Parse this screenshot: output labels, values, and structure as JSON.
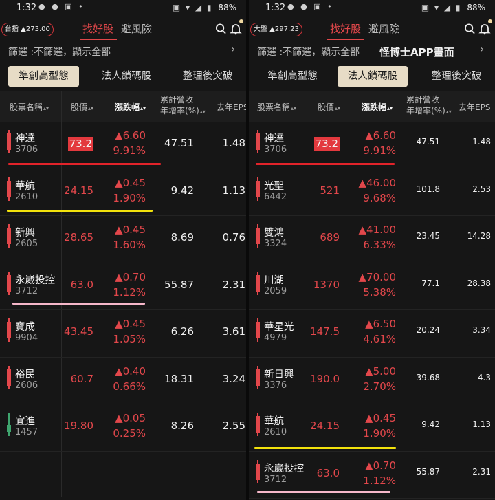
{
  "colors": {
    "up": "#e2474b",
    "down": "#3fa56e",
    "accent": "#e0474a",
    "red_line": "#e2232a",
    "yellow_line": "#f2e20c",
    "pink_line": "#f6b7c9"
  },
  "left": {
    "status": {
      "time": "1:32",
      "battery": "88%"
    },
    "index_badge": "台指 ▲273.00",
    "tabs": [
      "找好股",
      "避風險"
    ],
    "filter_label": "篩選 :不篩選，顯示全部",
    "filter_note": "",
    "segments": [
      "準創高型態",
      "法人鎖碼股",
      "整理後突破"
    ],
    "active_segment": 0,
    "headers": {
      "name": "股票名稱",
      "price": "股價",
      "change": "漲跌幅",
      "revenue": "累計營收",
      "revenue2": "年增率(%)",
      "eps": "去年EPS"
    },
    "rows": [
      {
        "name": "神達",
        "code": "3706",
        "price": "73.2",
        "highlight": true,
        "change": "▲6.60",
        "pct": "9.91%",
        "revenue": "47.51",
        "eps": "1.48",
        "candle": "up"
      },
      {
        "name": "華航",
        "code": "2610",
        "price": "24.15",
        "highlight": false,
        "change": "▲0.45",
        "pct": "1.90%",
        "revenue": "9.42",
        "eps": "1.13",
        "candle": "up"
      },
      {
        "name": "新興",
        "code": "2605",
        "price": "28.65",
        "highlight": false,
        "change": "▲0.45",
        "pct": "1.60%",
        "revenue": "8.69",
        "eps": "0.76",
        "candle": "up"
      },
      {
        "name": "永崴投控",
        "code": "3712",
        "price": "63.0",
        "highlight": false,
        "change": "▲0.70",
        "pct": "1.12%",
        "revenue": "55.87",
        "eps": "2.31",
        "candle": "up"
      },
      {
        "name": "寶成",
        "code": "9904",
        "price": "43.45",
        "highlight": false,
        "change": "▲0.45",
        "pct": "1.05%",
        "revenue": "6.26",
        "eps": "3.61",
        "candle": "up"
      },
      {
        "name": "裕民",
        "code": "2606",
        "price": "60.7",
        "highlight": false,
        "change": "▲0.40",
        "pct": "0.66%",
        "revenue": "18.31",
        "eps": "3.24",
        "candle": "up"
      },
      {
        "name": "宜進",
        "code": "1457",
        "price": "19.80",
        "highlight": false,
        "change": "▲0.05",
        "pct": "0.25%",
        "revenue": "8.26",
        "eps": "2.55",
        "candle": "down"
      }
    ]
  },
  "right": {
    "status": {
      "time": "1:32",
      "battery": "88%"
    },
    "index_badge": "大盤 ▲297.23",
    "tabs": [
      "找好股",
      "避風險"
    ],
    "filter_label": "篩選 :不篩選，顯示全部",
    "filter_note": "怪博士APP畫面",
    "segments": [
      "準創高型態",
      "法人鎖碼股",
      "整理後突破"
    ],
    "active_segment": 1,
    "headers": {
      "name": "股票名稱",
      "price": "股價",
      "change": "漲跌幅",
      "revenue": "累計營收",
      "revenue2": "年增率(%)",
      "eps": "去年EPS"
    },
    "rows": [
      {
        "name": "神達",
        "code": "3706",
        "price": "73.2",
        "highlight": true,
        "change": "▲6.60",
        "pct": "9.91%",
        "revenue": "47.51",
        "eps": "1.48",
        "candle": "up"
      },
      {
        "name": "光聖",
        "code": "6442",
        "price": "521",
        "highlight": false,
        "change": "▲46.00",
        "pct": "9.68%",
        "revenue": "101.8",
        "eps": "2.53",
        "candle": "up"
      },
      {
        "name": "雙鴻",
        "code": "3324",
        "price": "689",
        "highlight": false,
        "change": "▲41.00",
        "pct": "6.33%",
        "revenue": "23.45",
        "eps": "14.28",
        "candle": "up"
      },
      {
        "name": "川湖",
        "code": "2059",
        "price": "1370",
        "highlight": false,
        "change": "▲70.00",
        "pct": "5.38%",
        "revenue": "77.1",
        "eps": "28.38",
        "candle": "up"
      },
      {
        "name": "華星光",
        "code": "4979",
        "price": "147.5",
        "highlight": false,
        "change": "▲6.50",
        "pct": "4.61%",
        "revenue": "20.24",
        "eps": "3.34",
        "candle": "up"
      },
      {
        "name": "新日興",
        "code": "3376",
        "price": "190.0",
        "highlight": false,
        "change": "▲5.00",
        "pct": "2.70%",
        "revenue": "39.68",
        "eps": "4.3",
        "candle": "up"
      },
      {
        "name": "華航",
        "code": "2610",
        "price": "24.15",
        "highlight": false,
        "change": "▲0.45",
        "pct": "1.90%",
        "revenue": "9.42",
        "eps": "1.13",
        "candle": "up"
      },
      {
        "name": "永崴投控",
        "code": "3712",
        "price": "63.0",
        "highlight": false,
        "change": "▲0.70",
        "pct": "1.12%",
        "revenue": "55.87",
        "eps": "2.31",
        "candle": "up"
      }
    ]
  }
}
